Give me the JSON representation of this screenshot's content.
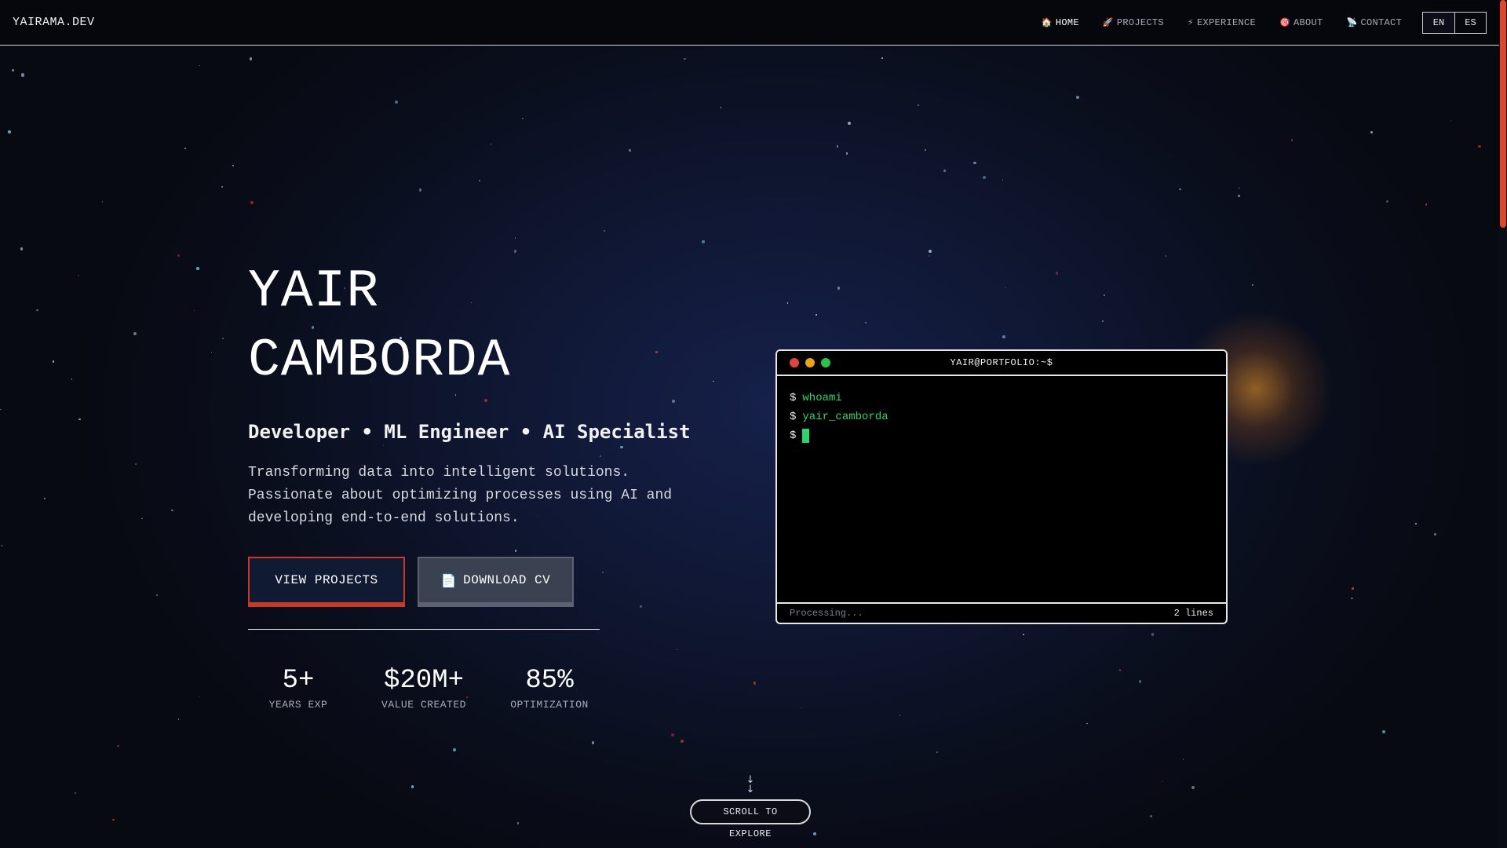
{
  "nav": {
    "brand": "YAIRAMA.DEV",
    "links": [
      {
        "icon": "home-icon",
        "glyph": "🏠",
        "label": "HOME",
        "active": true
      },
      {
        "icon": "rocket-icon",
        "glyph": "🚀",
        "label": "PROJECTS",
        "active": false
      },
      {
        "icon": "lightning-icon",
        "glyph": "⚡",
        "label": "EXPERIENCE",
        "active": false
      },
      {
        "icon": "target-icon",
        "glyph": "🎯",
        "label": "ABOUT",
        "active": false
      },
      {
        "icon": "satellite-icon",
        "glyph": "📡",
        "label": "CONTACT",
        "active": false
      }
    ],
    "languages": [
      "EN",
      "ES"
    ]
  },
  "hero": {
    "name_line1": "YAIR",
    "name_line2": "CAMBORDA",
    "role": "Developer • ML Engineer • AI Specialist",
    "description": "Transforming data into intelligent solutions. Passionate about optimizing processes using AI and developing end-to-end solutions.",
    "primary_button": "VIEW PROJECTS",
    "secondary_button": "DOWNLOAD CV",
    "secondary_icon": "📄",
    "stats": [
      {
        "value": "5+",
        "label": "YEARS EXP"
      },
      {
        "value": "$20M+",
        "label": "VALUE CREATED"
      },
      {
        "value": "85%",
        "label": "OPTIMIZATION"
      }
    ]
  },
  "terminal": {
    "title": "YAIR@PORTFOLIO:~$",
    "prompt": "$",
    "lines": [
      "whoami",
      "yair_camborda"
    ],
    "status": "Processing...",
    "line_count": "2 lines"
  },
  "scroll_hint": {
    "arrows": "↓\n↓",
    "label": "SCROLL TO EXPLORE"
  },
  "colors": {
    "accent": "#c83a26",
    "terminal_green": "#2fd36b",
    "dot_red": "#e0443e",
    "dot_yellow": "#e8a21c",
    "dot_green": "#2cc24a"
  }
}
